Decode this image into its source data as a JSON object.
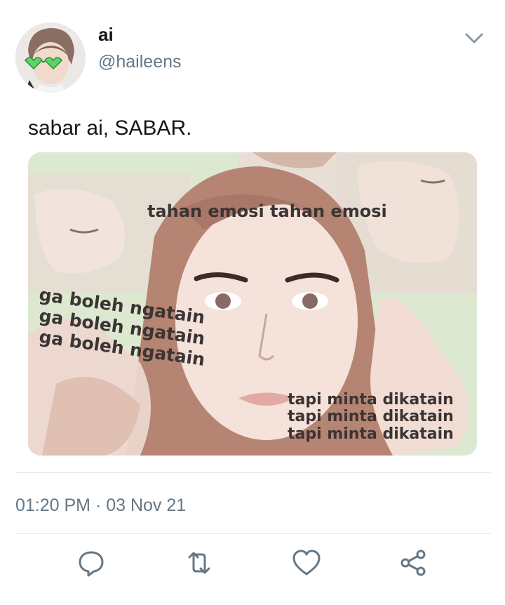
{
  "tweet": {
    "display_name": "ai",
    "handle": "@haileens",
    "text": "sabar ai, SABAR.",
    "timestamp": "01:20 PM · 03 Nov 21"
  },
  "media": {
    "caption_top": "tahan emosi tahan emosi",
    "caption_left": [
      "ga boleh ngatain",
      "ga boleh ngatain",
      "ga boleh ngatain"
    ],
    "caption_right": [
      "tapi minta dikatain",
      "tapi minta dikatain",
      "tapi minta dikatain"
    ]
  },
  "actions": {
    "icons": [
      "reply-icon",
      "retweet-icon",
      "like-icon",
      "share-icon"
    ]
  },
  "colors": {
    "text": "#14171a",
    "secondary": "#657786",
    "divider": "#e1e8ed",
    "icon": "#657786"
  }
}
